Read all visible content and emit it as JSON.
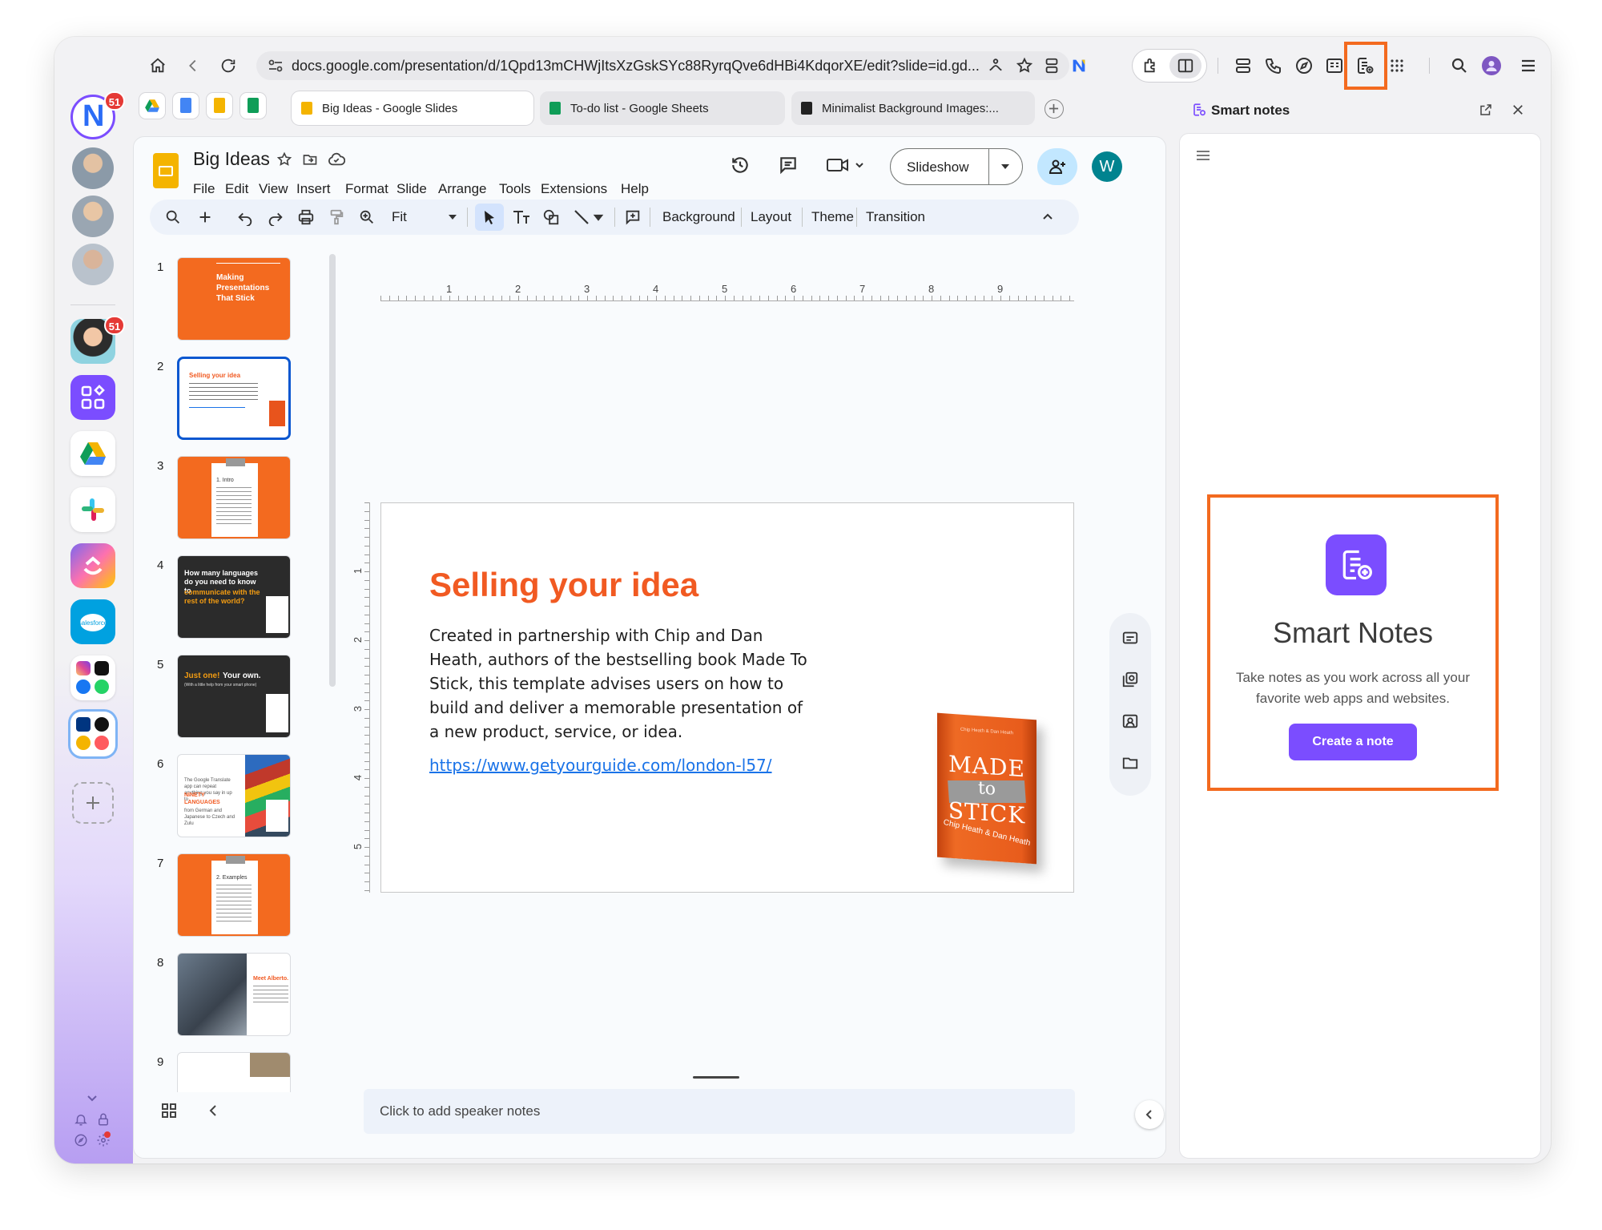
{
  "browser": {
    "url": "docs.google.com/presentation/d/1Qpd13mCHWjItsXzGskSYc88RyrqQve6dHBi4KdqorXE/edit?slide=id.gd...",
    "tabs": [
      {
        "label": "Big Ideas - Google Slides",
        "color": "#f4b400"
      },
      {
        "label": "To-do list - Google Sheets",
        "color": "#0f9d58"
      },
      {
        "label": "Minimalist Background Images:...",
        "color": "#222222"
      }
    ],
    "avatar_letter": "N",
    "rail_badge_1": "51",
    "rail_badge_2": "51"
  },
  "slides_app": {
    "doc_title": "Big Ideas",
    "menu": [
      "File",
      "Edit",
      "View",
      "Insert",
      "Format",
      "Slide",
      "Arrange",
      "Tools",
      "Extensions",
      "Help"
    ],
    "slideshow_label": "Slideshow",
    "user_initial": "W",
    "toolbar": {
      "zoom": "Fit",
      "background": "Background",
      "layout": "Layout",
      "theme": "Theme",
      "transition": "Transition"
    },
    "ruler_top": [
      "1",
      "2",
      "3",
      "4",
      "5",
      "6",
      "7",
      "8",
      "9"
    ],
    "ruler_left": [
      "1",
      "2",
      "3",
      "4",
      "5"
    ],
    "thumbnails": [
      {
        "num": "1",
        "title": "Making Presentations That Stick"
      },
      {
        "num": "2",
        "title": "Selling your idea"
      },
      {
        "num": "3",
        "title": "1. Intro"
      },
      {
        "num": "4",
        "title": "How many languages do you need to know to",
        "highlight": "communicate with the rest of the world?"
      },
      {
        "num": "5",
        "title": "Just one!",
        "title2": "Your own.",
        "sub": "(With a little help from your smart phone)"
      },
      {
        "num": "6",
        "title": "The Google Translate app can repeat anything you say in up to",
        "highlight": "NINETY LANGUAGES",
        "tail": "from German and Japanese to Czech and Zulu"
      },
      {
        "num": "7",
        "title": "2. Examples"
      },
      {
        "num": "8",
        "title": "Meet Alberto."
      },
      {
        "num": "9",
        "title": ""
      }
    ],
    "slide": {
      "title": "Selling your idea",
      "body": "Created in partnership with Chip and Dan Heath, authors of the bestselling book Made To Stick, this template advises users on how to build and deliver a memorable presentation of a new product, service, or idea.",
      "link": "https://www.getyourguide.com/london-l57/",
      "book": {
        "line1": "MADE",
        "line2": "to",
        "line3": "STICK",
        "authors": "Chip Heath & Dan Heath"
      }
    },
    "speaker_notes_placeholder": "Click to add speaker notes"
  },
  "side_panel": {
    "header": "Smart notes",
    "card_title": "Smart Notes",
    "card_desc": "Take notes as you work across all your favorite web apps and websites.",
    "create_button": "Create a note"
  },
  "colors": {
    "accent_orange": "#f36a1f",
    "brand_purple": "#7b4dff",
    "slide_orange": "#f15a22",
    "link_blue": "#1a73e8"
  }
}
